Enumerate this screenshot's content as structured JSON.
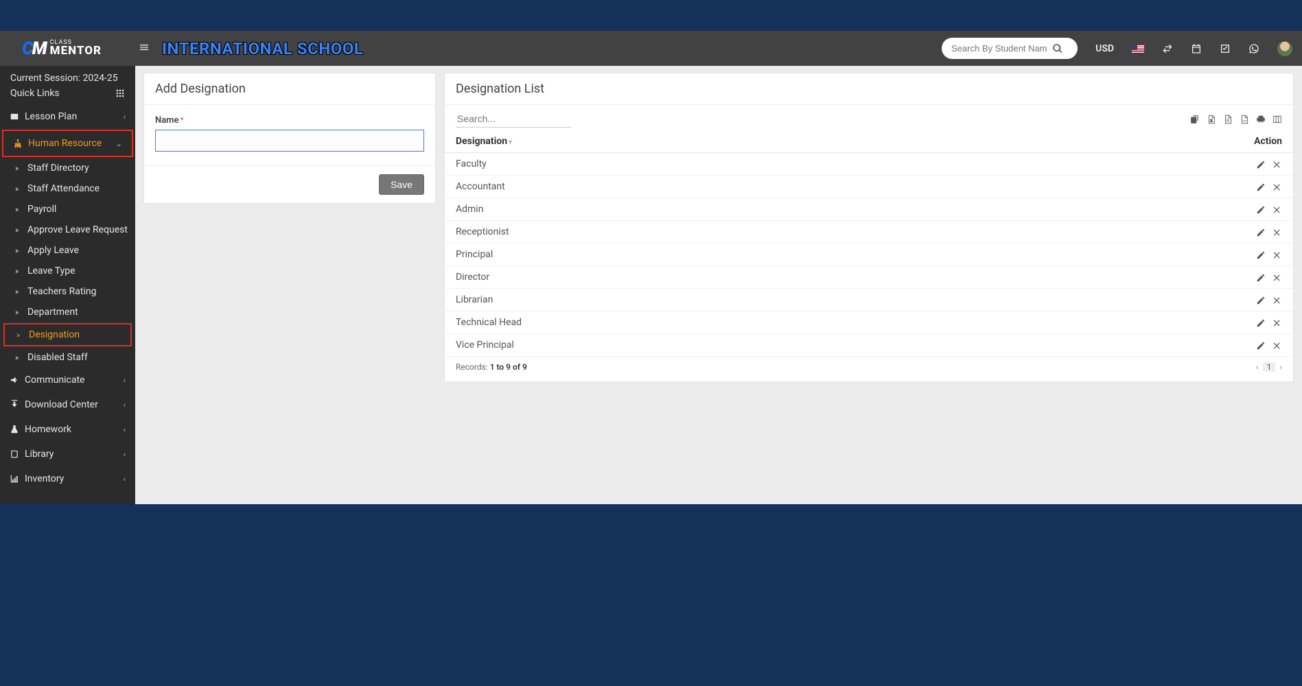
{
  "logo": {
    "class_text": "CLASS",
    "mentor_text": "MENTOR"
  },
  "school_name": "INTERNATIONAL SCHOOL",
  "search_placeholder": "Search By Student Nam",
  "currency": "USD",
  "session": {
    "label": "Current Session: 2024-25",
    "quick_links": "Quick Links"
  },
  "sidebar": {
    "lesson_plan": "Lesson Plan",
    "human_resource": "Human Resource",
    "hr_sub": {
      "staff_directory": "Staff Directory",
      "staff_attendance": "Staff Attendance",
      "payroll": "Payroll",
      "approve_leave": "Approve Leave Request",
      "apply_leave": "Apply Leave",
      "leave_type": "Leave Type",
      "teachers_rating": "Teachers Rating",
      "department": "Department",
      "designation": "Designation",
      "disabled_staff": "Disabled Staff"
    },
    "communicate": "Communicate",
    "download_center": "Download Center",
    "homework": "Homework",
    "library": "Library",
    "inventory": "Inventory"
  },
  "add_panel": {
    "title": "Add Designation",
    "name_label": "Name",
    "name_value": "",
    "save_label": "Save"
  },
  "list_panel": {
    "title": "Designation List",
    "search_placeholder": "Search...",
    "col_designation": "Designation",
    "col_action": "Action",
    "rows": [
      "Faculty",
      "Accountant",
      "Admin",
      "Receptionist",
      "Principal",
      "Director",
      "Librarian",
      "Technical Head",
      "Vice Principal"
    ],
    "records_prefix": "Records: ",
    "records_range": "1 to 9 of 9",
    "page_number": "1"
  }
}
